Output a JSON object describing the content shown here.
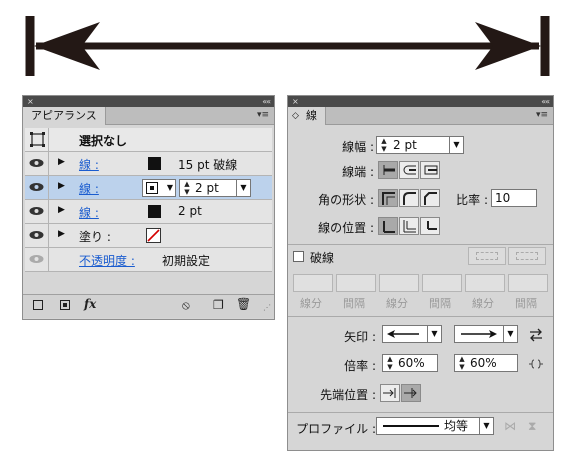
{
  "appearance": {
    "tab": "アピアランス",
    "header": "選択なし",
    "rows": [
      {
        "label": "線 :",
        "value": "15 pt 破線"
      },
      {
        "label": "線 :",
        "value": "2 pt"
      },
      {
        "label": "線 :",
        "value": "2 pt"
      },
      {
        "label": "塗り :"
      },
      {
        "label": "不透明度 :",
        "value": "初期設定"
      }
    ]
  },
  "stroke": {
    "tab": "線",
    "weight_label": "線幅 :",
    "weight_value": "2 pt",
    "cap_label": "線端 :",
    "join_label": "角の形状 :",
    "limit_label": "比率 :",
    "limit_value": "10",
    "align_label": "線の位置 :",
    "dashed_label": "破線",
    "dash_labels": [
      "線分",
      "間隔",
      "線分",
      "間隔",
      "線分",
      "間隔"
    ],
    "arrow_label": "矢印 :",
    "scale_label": "倍率 :",
    "scale_start": "60%",
    "scale_end": "60%",
    "tip_label": "先端位置 :",
    "profile_label": "プロファイル :",
    "profile_value": "均等"
  },
  "icons": {
    "close": "×",
    "collapse": "««",
    "menu": "▾≡",
    "disclosure": "▶",
    "dropdown": "▼",
    "fx": "fx"
  },
  "colors": {
    "panel_bg": "#d6d6d6",
    "selected_row": "#bcd2ec",
    "link": "#1a5ccf",
    "arrow": "#231815"
  }
}
